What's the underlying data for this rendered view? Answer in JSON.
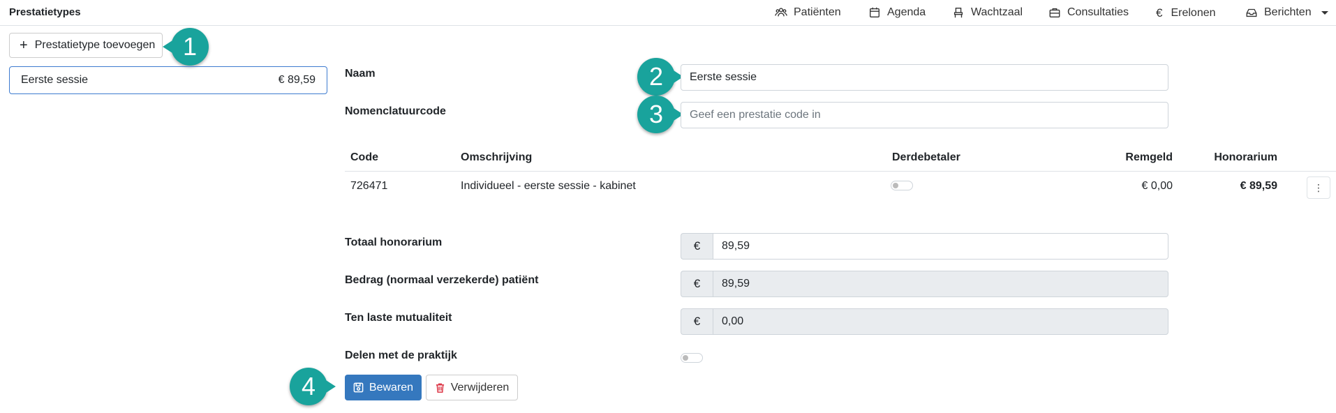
{
  "header": {
    "title": "Prestatietypes",
    "nav": [
      {
        "label": "Patiënten",
        "icon": "users-icon"
      },
      {
        "label": "Agenda",
        "icon": "calendar-icon"
      },
      {
        "label": "Wachtzaal",
        "icon": "chair-icon"
      },
      {
        "label": "Consultaties",
        "icon": "briefcase-icon"
      },
      {
        "label": "Erelonen",
        "icon": "euro-icon"
      },
      {
        "label": "Berichten",
        "icon": "inbox-icon"
      }
    ]
  },
  "sidebar": {
    "add_button_label": "Prestatietype toevoegen",
    "items": [
      {
        "name": "Eerste sessie",
        "price": "€ 89,59"
      }
    ]
  },
  "form": {
    "naam_label": "Naam",
    "naam_value": "Eerste sessie",
    "code_label": "Nomenclatuurcode",
    "code_placeholder": "Geef een prestatie code in"
  },
  "table": {
    "headers": [
      "Code",
      "Omschrijving",
      "Derdebetaler",
      "Remgeld",
      "Honorarium"
    ],
    "rows": [
      {
        "code": "726471",
        "omschrijving": "Individueel - eerste sessie - kabinet",
        "derdebetaler": false,
        "remgeld": "€ 0,00",
        "honorarium": "€ 89,59"
      }
    ]
  },
  "totals": {
    "currency_symbol": "€",
    "totaal_label": "Totaal honorarium",
    "totaal_value": "89,59",
    "patient_label": "Bedrag (normaal verzekerde) patiënt",
    "patient_value": "89,59",
    "mutualiteit_label": "Ten laste mutualiteit",
    "mutualiteit_value": "0,00",
    "delen_label": "Delen met de praktijk",
    "delen_enabled": false
  },
  "actions": {
    "save_label": "Bewaren",
    "delete_label": "Verwijderen"
  },
  "annotations": [
    "1",
    "2",
    "3",
    "4"
  ],
  "colors": {
    "badge": "#19a39c",
    "primary": "#3578be",
    "danger": "#dc3545",
    "selected_border": "#3d7bd0"
  }
}
